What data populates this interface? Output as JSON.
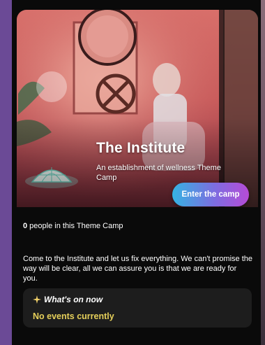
{
  "camp": {
    "title": "The Institute",
    "subtitle": "An establishment of wellness Theme Camp",
    "enter_label": "Enter the camp"
  },
  "stats": {
    "count": "0",
    "suffix": " people in this Theme Camp"
  },
  "description": "Come to the Institute and let us fix everything. We can't promise the way will be clear, all we can assure you is that we are ready for you.",
  "whats_on": {
    "heading": "What's on now",
    "empty_label": "No events currently"
  },
  "colors": {
    "accent_gradient": [
      "#35b3e2",
      "#7d6de0",
      "#b64bd6"
    ],
    "empty_text": "#e5cf5a",
    "page_bg": "#6b4a96"
  },
  "icons": [
    "sparkle-icon",
    "dome-icon"
  ]
}
